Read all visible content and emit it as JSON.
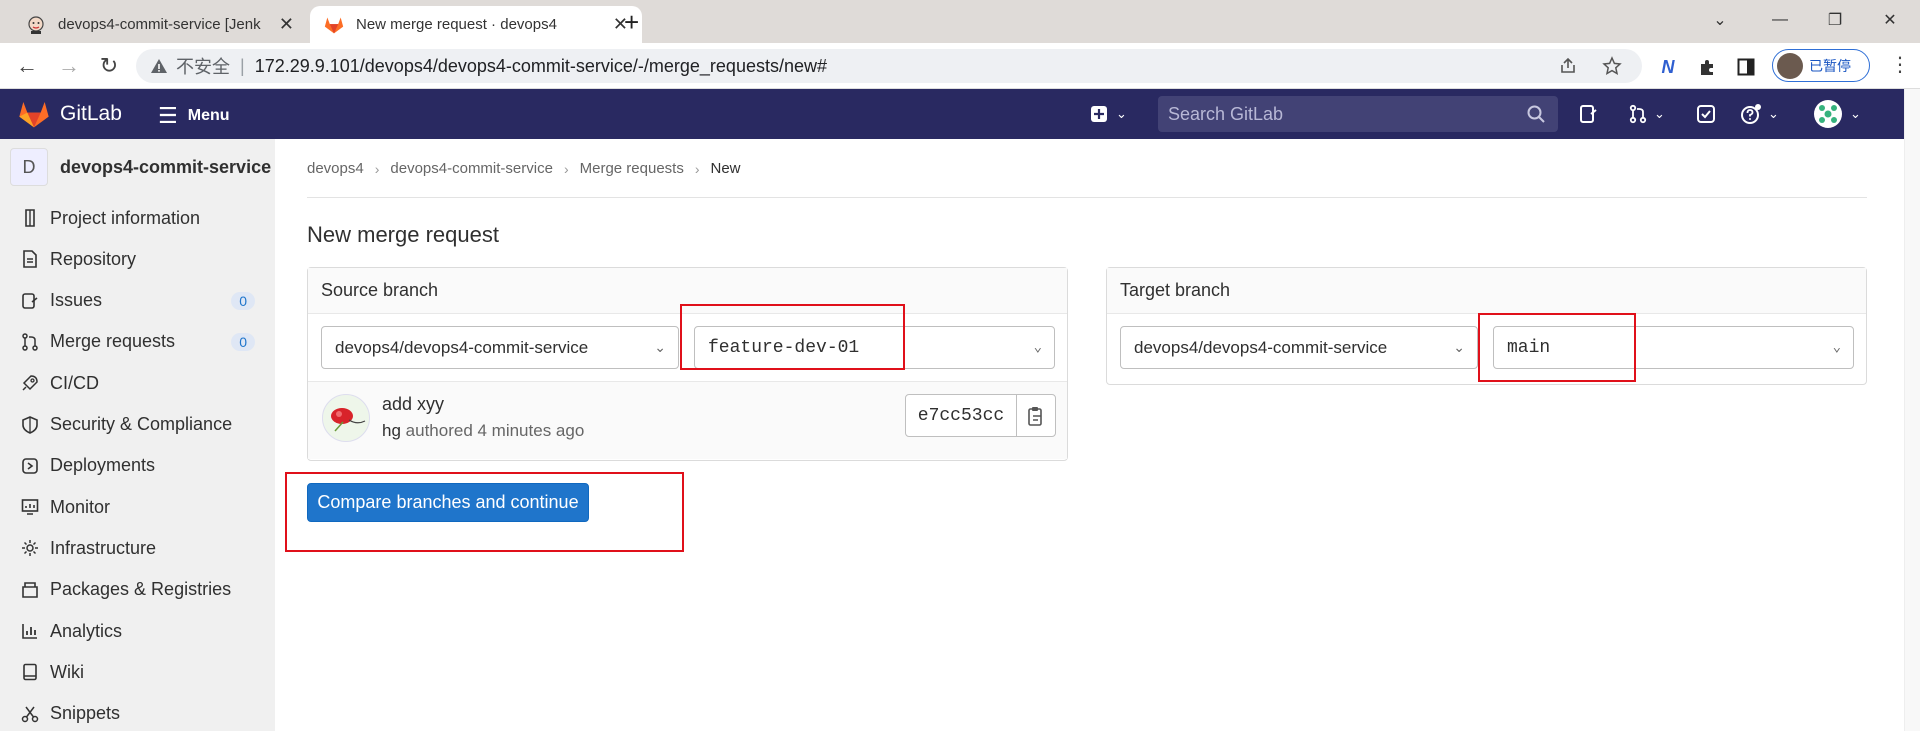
{
  "browser": {
    "tabs": [
      {
        "title": "devops4-commit-service [Jenk",
        "active": false
      },
      {
        "title": "New merge request · devops4",
        "active": true
      }
    ],
    "insecure_label": "不安全",
    "url": "172.29.9.101/devops4/devops4-commit-service/-/merge_requests/new#",
    "profile_label": "已暂停"
  },
  "header": {
    "brand": "GitLab",
    "menu_label": "Menu",
    "search_placeholder": "Search GitLab"
  },
  "sidebar": {
    "project_initial": "D",
    "project_name": "devops4-commit-service",
    "items": [
      {
        "label": "Project information",
        "icon": "info-icon"
      },
      {
        "label": "Repository",
        "icon": "doc-icon"
      },
      {
        "label": "Issues",
        "icon": "issues-icon",
        "badge": "0"
      },
      {
        "label": "Merge requests",
        "icon": "merge-icon",
        "badge": "0"
      },
      {
        "label": "CI/CD",
        "icon": "rocket-icon"
      },
      {
        "label": "Security & Compliance",
        "icon": "shield-icon"
      },
      {
        "label": "Deployments",
        "icon": "deploy-icon"
      },
      {
        "label": "Monitor",
        "icon": "monitor-icon"
      },
      {
        "label": "Infrastructure",
        "icon": "cloud-icon"
      },
      {
        "label": "Packages & Registries",
        "icon": "package-icon"
      },
      {
        "label": "Analytics",
        "icon": "chart-icon"
      },
      {
        "label": "Wiki",
        "icon": "book-icon"
      },
      {
        "label": "Snippets",
        "icon": "scissors-icon"
      }
    ]
  },
  "breadcrumb": [
    "devops4",
    "devops4-commit-service",
    "Merge requests",
    "New"
  ],
  "page_title": "New merge request",
  "source": {
    "heading": "Source branch",
    "project": "devops4/devops4-commit-service",
    "branch": "feature-dev-01",
    "commit_message": "add xyy",
    "commit_author": "hg",
    "commit_meta": "authored 4 minutes ago",
    "commit_sha": "e7cc53cc"
  },
  "target": {
    "heading": "Target branch",
    "project": "devops4/devops4-commit-service",
    "branch": "main"
  },
  "compare_button": "Compare branches and continue",
  "colors": {
    "header_bg": "#292961",
    "primary": "#1f75cb",
    "highlight": "#e0101a"
  }
}
